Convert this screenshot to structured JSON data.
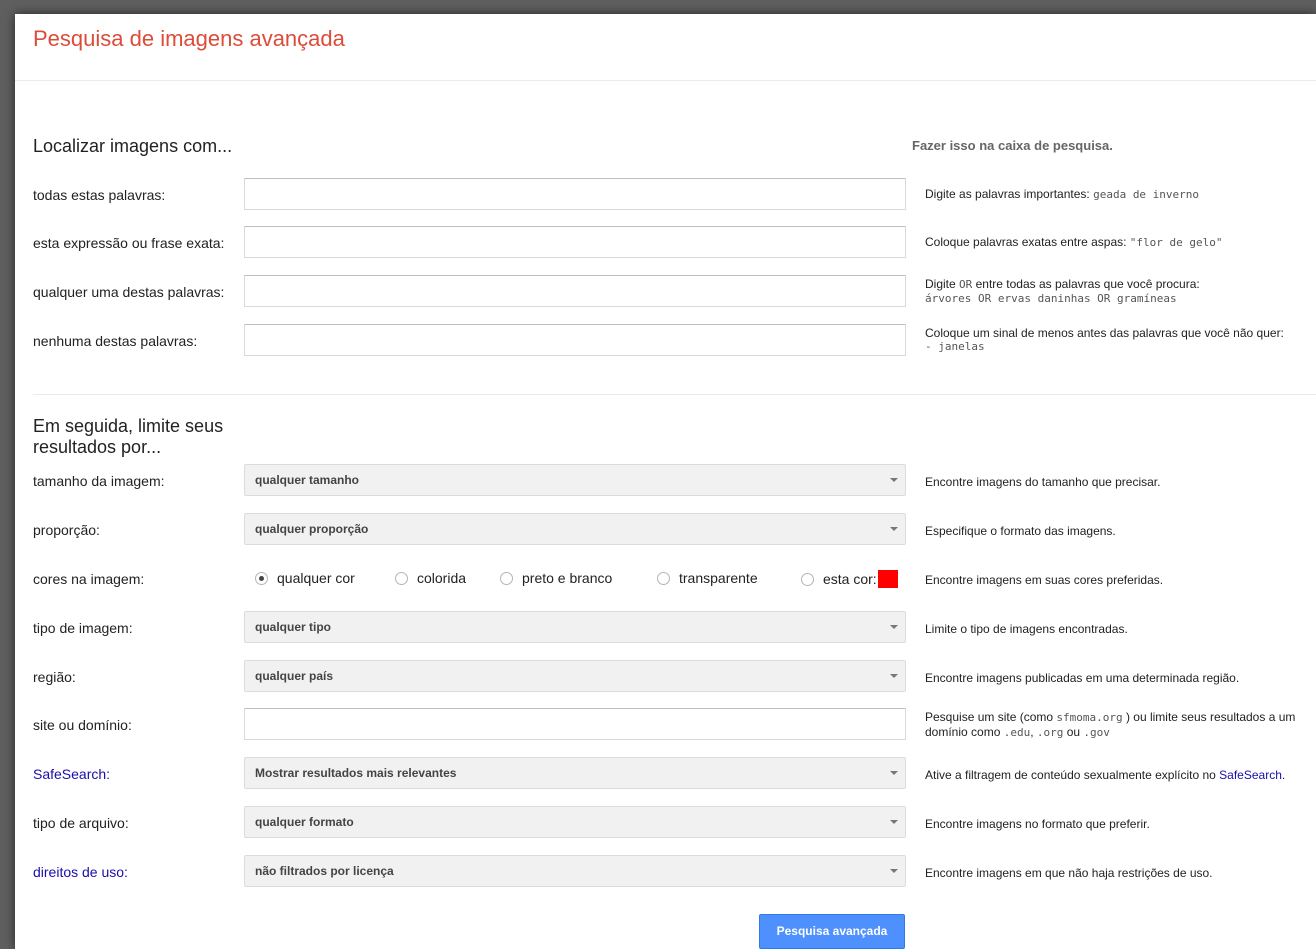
{
  "title": "Pesquisa de imagens avançada",
  "find_section": {
    "heading": "Localizar imagens com...",
    "right_heading": "Fazer isso na caixa de pesquisa."
  },
  "fields": [
    {
      "label": "todas estas palavras:",
      "value": "",
      "hint_text": "Digite as palavras importantes: ",
      "hint_code": "geada de inverno"
    },
    {
      "label": "esta expressão ou frase exata:",
      "value": "",
      "hint_text": "Coloque palavras exatas entre aspas: ",
      "hint_code": "\"flor de gelo\""
    },
    {
      "label": "qualquer uma destas palavras:",
      "value": "",
      "hint_line1_a": "Digite ",
      "hint_line1_code": "OR",
      "hint_line1_b": " entre todas as palavras que você procura:",
      "hint_line2": "árvores OR ervas daninhas OR gramíneas"
    },
    {
      "label": "nenhuma destas palavras:",
      "value": "",
      "hint_line1": "Coloque um sinal de menos antes das palavras que você não quer:",
      "hint_line2": "- janelas"
    }
  ],
  "limit_section": {
    "heading_line1": "Em seguida, limite seus",
    "heading_line2": "resultados por..."
  },
  "size": {
    "label": "tamanho da imagem:",
    "selected": "qualquer tamanho",
    "hint": "Encontre imagens do tamanho que precisar."
  },
  "aspect": {
    "label": "proporção:",
    "selected": "qualquer proporção",
    "hint": "Especifique o formato das imagens."
  },
  "colors": {
    "label": "cores na imagem:",
    "options": [
      "qualquer cor",
      "colorida",
      "preto e branco",
      "transparente",
      "esta cor:"
    ],
    "selected_index": 0,
    "swatch_color": "#ff0000",
    "hint": "Encontre imagens em suas cores preferidas."
  },
  "type": {
    "label": "tipo de imagem:",
    "selected": "qualquer tipo",
    "hint": "Limite o tipo de imagens encontradas."
  },
  "region": {
    "label": "região:",
    "selected": "qualquer país",
    "hint": "Encontre imagens publicadas em uma determinada região."
  },
  "site": {
    "label": "site ou domínio:",
    "value": "",
    "hint_a": "Pesquise um site (como ",
    "hint_code1": "sfmoma.org",
    "hint_b": " ) ou limite seus resultados a um",
    "hint_c": "domínio como ",
    "hint_code2": ".edu",
    "hint_d": ", ",
    "hint_code3": ".org",
    "hint_e": " ou ",
    "hint_code4": ".gov"
  },
  "safesearch": {
    "label": "SafeSearch:",
    "selected": "Mostrar resultados mais relevantes",
    "hint_a": "Ative a filtragem de conteúdo sexualmente explícito no ",
    "hint_link": "SafeSearch",
    "hint_b": "."
  },
  "filetype": {
    "label": "tipo de arquivo:",
    "selected": "qualquer formato",
    "hint": "Encontre imagens no formato que preferir."
  },
  "rights": {
    "label": "direitos de uso:",
    "selected": "não filtrados por licença",
    "hint": "Encontre imagens em que não haja restrições de uso."
  },
  "submit_label": "Pesquisa avançada",
  "colors_palette": {
    "title_red": "#dd4b39",
    "link_blue": "#1a0dab",
    "button_blue": "#4d90fe"
  }
}
